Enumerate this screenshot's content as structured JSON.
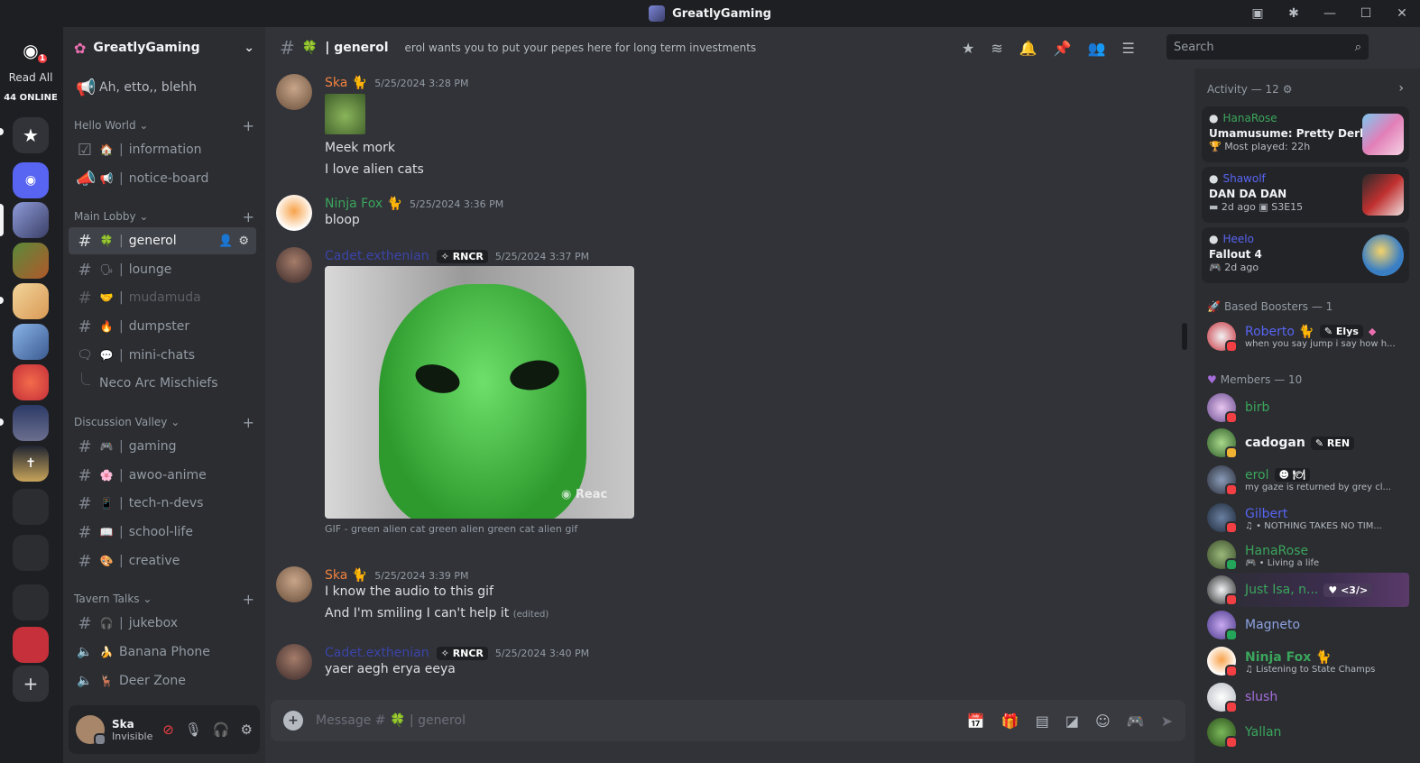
{
  "window": {
    "title": "GreatlyGaming"
  },
  "rail": {
    "badge": "1",
    "read_all": "Read All",
    "online": "44 ONLINE"
  },
  "server": {
    "name": "GreatlyGaming",
    "top_item": "Ah, etto,, blehh"
  },
  "categories": [
    {
      "name": "Hello World ⌄",
      "channels": [
        {
          "emoji": "🏠",
          "name": "information",
          "icon": "rules-icon"
        },
        {
          "emoji": "📢",
          "name": "notice-board",
          "icon": "announcement-icon"
        }
      ]
    },
    {
      "name": "Main Lobby ⌄",
      "channels": [
        {
          "emoji": "🍀",
          "name": "generol",
          "active": true
        },
        {
          "emoji": "🗣",
          "name": "lounge"
        },
        {
          "emoji": "🤝",
          "name": "mudamuda",
          "muted": true
        },
        {
          "emoji": "🔥",
          "name": "dumpster"
        },
        {
          "emoji": "💬",
          "name": "mini-chats",
          "icon": "forum-icon"
        }
      ]
    },
    {
      "name": "Discussion Valley ⌄",
      "channels": [
        {
          "emoji": "🎮",
          "name": "gaming"
        },
        {
          "emoji": "🌸",
          "name": "awoo-anime"
        },
        {
          "emoji": "📱",
          "name": "tech-n-devs"
        },
        {
          "emoji": "📖",
          "name": "school-life"
        },
        {
          "emoji": "🎨",
          "name": "creative"
        }
      ]
    },
    {
      "name": "Tavern Talks ⌄",
      "channels": [
        {
          "emoji": "🎧",
          "name": "jukebox"
        },
        {
          "emoji": "🍌",
          "name": "Banana Phone",
          "icon": "voice-icon"
        },
        {
          "emoji": "🦌",
          "name": "Deer Zone",
          "icon": "voice-icon"
        }
      ]
    }
  ],
  "thread": "Neco Arc Mischiefs",
  "user": {
    "name": "Ska",
    "status": "Invisible"
  },
  "channel": {
    "name": "generol",
    "emoji": "🍀",
    "topic": "erol wants you to put your pepes here for long term investments"
  },
  "search": {
    "placeholder": "Search"
  },
  "messages": [
    {
      "author": "Ska 🐈",
      "color": "#f0813f",
      "time": "5/25/2024 3:28 PM",
      "lines": [
        "Meek mork",
        "I love alien cats"
      ]
    },
    {
      "author": "Ninja Fox 🐈",
      "color": "#3ba55c",
      "time": "5/25/2024 3:36 PM",
      "lines": [
        "bloop"
      ]
    },
    {
      "author": "Cadet.exthenian",
      "color": "#3b44a8",
      "tag": "RNCR",
      "time": "5/25/2024 3:37 PM",
      "caption": "GIF - green alien cat green alien green cat alien gif",
      "watermark": "Reac"
    },
    {
      "author": "Ska 🐈",
      "color": "#f0813f",
      "time": "5/25/2024 3:39 PM",
      "lines": [
        "I know the audio to this gif",
        "And I'm smiling I can't help it"
      ],
      "edited": "(edited)"
    },
    {
      "author": "Cadet.exthenian",
      "color": "#3b44a8",
      "tag": "RNCR",
      "time": "5/25/2024 3:40 PM",
      "lines": [
        "yaer aegh erya eeya"
      ]
    }
  ],
  "composer": {
    "placeholder": "Message #",
    "channel": "generol"
  },
  "activity": {
    "header": "Activity — 12",
    "items": [
      {
        "user": "HanaRose",
        "ucolor": "#3ba55c",
        "game": "Umamusume: Pretty Derby",
        "sub": "🏆 Most played: 22h"
      },
      {
        "user": "Shawolf",
        "ucolor": "#5865f2",
        "game": "DAN DA DAN",
        "sub": "▬ 2d ago  ▣ S3E15"
      },
      {
        "user": "Heelo",
        "ucolor": "#5865f2",
        "game": "Fallout 4",
        "sub": "🎮 2d ago"
      }
    ]
  },
  "boosters": {
    "header": "Based Boosters — 1",
    "members": [
      {
        "name": "Roberto 🐈",
        "color": "#5865f2",
        "tag": "Elys",
        "sub": "when you say jump i say how h..."
      }
    ]
  },
  "members": {
    "header": "Members — 10",
    "list": [
      {
        "name": "birb",
        "color": "#3ba55c",
        "status": "#f23f43"
      },
      {
        "name": "cadogan",
        "color": "#f2f3f5",
        "tag": "REN",
        "status": "#f0b232"
      },
      {
        "name": "erol",
        "color": "#3ba55c",
        "tag": "🍽",
        "sub": "my gaze is returned by grey cl...",
        "status": "#f23f43"
      },
      {
        "name": "Gilbert",
        "color": "#5865f2",
        "sub": "♫ • NOTHING TAKES NO TIM...",
        "status": "#f23f43"
      },
      {
        "name": "HanaRose",
        "color": "#3ba55c",
        "sub": "🎮 • Living a life",
        "status": "#23a55a"
      },
      {
        "name": "Just Isa, n...",
        "color": "#3ba55c",
        "tag": "<3/>",
        "status": "#f23f43"
      },
      {
        "name": "Magneto",
        "color": "#8ea1e1",
        "status": "#23a55a"
      },
      {
        "name": "Ninja Fox 🐈",
        "color": "#3ba55c",
        "sub": "♫ Listening to State Champs",
        "status": "#f23f43"
      },
      {
        "name": "slush",
        "color": "#a56ddc",
        "status": "#f23f43"
      },
      {
        "name": "Yallan",
        "color": "#3ba55c",
        "status": "#f23f43"
      }
    ]
  }
}
